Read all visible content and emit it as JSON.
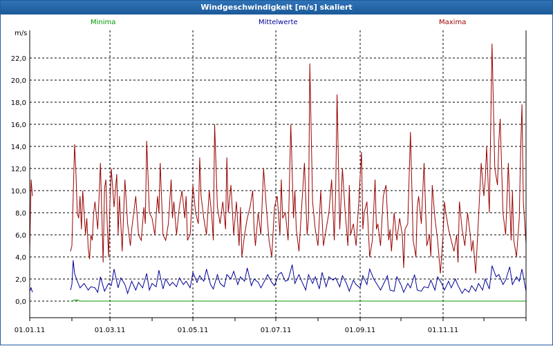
{
  "window": {
    "title": "Windgeschwindigkeit [m/s] skaliert"
  },
  "colors": {
    "minima": "#009900",
    "mean": "#000099",
    "maxima": "#990000",
    "grid": "#000000",
    "axis": "#000000"
  },
  "chart_data": {
    "type": "line",
    "title": "Windgeschwindigkeit [m/s] skaliert",
    "ylabel": "m/s",
    "xlabel": "",
    "ylim": [
      -1.5,
      24.5
    ],
    "yticks": [
      "0,0",
      "2,0",
      "4,0",
      "6,0",
      "8,0",
      "10,0",
      "12,0",
      "14,0",
      "16,0",
      "18,0",
      "20,0",
      "22,0"
    ],
    "ytick_values": [
      0,
      2,
      4,
      6,
      8,
      10,
      12,
      14,
      16,
      18,
      20,
      22
    ],
    "xlim": [
      0,
      365
    ],
    "xticks": [
      "01.01.11",
      "01.03.11",
      "01.05.11",
      "01.07.11",
      "01.09.11",
      "01.11.11"
    ],
    "xtick_days": [
      0,
      59,
      120,
      181,
      243,
      304
    ],
    "grid": true,
    "legend": [
      "Minima",
      "Mittelwerte",
      "Maxima"
    ],
    "series": [
      {
        "name": "Minima",
        "x": [
          0,
          2,
          5,
          30,
          31,
          33,
          35,
          37,
          40,
          45,
          50,
          60,
          70,
          80,
          90,
          100,
          110,
          120,
          130,
          140,
          150,
          160,
          170,
          180,
          190,
          200,
          210,
          220,
          230,
          240,
          250,
          260,
          270,
          280,
          290,
          300,
          310,
          320,
          330,
          340,
          350,
          360,
          365
        ],
        "values": [
          null,
          null,
          null,
          0.0,
          0.0,
          0.1,
          0.1,
          0.0,
          0.0,
          0.0,
          0.0,
          0.0,
          0.0,
          0.0,
          0.0,
          0.0,
          0.0,
          0.0,
          0.0,
          0.0,
          0.0,
          0.0,
          0.0,
          0.0,
          0.0,
          0.0,
          0.0,
          0.0,
          0.0,
          0.0,
          0.0,
          0.0,
          0.0,
          0.0,
          0.0,
          0.0,
          0.0,
          0.0,
          0.0,
          0.0,
          0.0,
          0.0,
          0.0
        ]
      },
      {
        "name": "Mittelwerte",
        "x": [
          0,
          1,
          2,
          30,
          31,
          32,
          33,
          35,
          37,
          40,
          43,
          45,
          48,
          50,
          52,
          55,
          58,
          60,
          62,
          65,
          67,
          70,
          72,
          75,
          78,
          80,
          83,
          86,
          88,
          90,
          93,
          95,
          98,
          100,
          103,
          105,
          108,
          110,
          113,
          115,
          118,
          120,
          123,
          125,
          128,
          130,
          133,
          135,
          138,
          140,
          143,
          145,
          148,
          150,
          153,
          155,
          158,
          160,
          163,
          165,
          168,
          170,
          173,
          175,
          178,
          180,
          183,
          185,
          188,
          190,
          193,
          195,
          198,
          200,
          203,
          205,
          208,
          210,
          213,
          215,
          218,
          220,
          223,
          225,
          228,
          230,
          233,
          235,
          238,
          240,
          243,
          245,
          248,
          250,
          253,
          255,
          258,
          260,
          263,
          265,
          268,
          270,
          273,
          275,
          278,
          280,
          283,
          285,
          288,
          290,
          293,
          295,
          298,
          300,
          303,
          305,
          308,
          310,
          313,
          315,
          318,
          320,
          323,
          325,
          328,
          330,
          333,
          335,
          338,
          340,
          343,
          345,
          348,
          350,
          353,
          355,
          358,
          360,
          362,
          365
        ],
        "values": [
          0.9,
          1.2,
          0.8,
          1.0,
          1.5,
          3.7,
          2.5,
          1.8,
          1.2,
          1.6,
          1.0,
          1.3,
          1.2,
          0.8,
          2.2,
          0.9,
          1.6,
          1.4,
          2.9,
          1.2,
          2.1,
          1.5,
          0.7,
          1.8,
          1.0,
          1.7,
          1.2,
          2.5,
          1.0,
          1.6,
          1.3,
          2.8,
          1.1,
          2.0,
          1.4,
          1.7,
          1.3,
          2.1,
          1.5,
          1.8,
          1.2,
          2.6,
          1.7,
          2.3,
          1.8,
          2.9,
          1.5,
          1.1,
          2.4,
          1.6,
          1.3,
          2.4,
          2.0,
          2.7,
          1.5,
          2.2,
          1.8,
          3.0,
          1.4,
          2.0,
          1.7,
          1.2,
          1.9,
          2.4,
          1.7,
          1.4,
          2.4,
          2.6,
          1.8,
          1.9,
          3.3,
          1.6,
          2.4,
          1.8,
          1.0,
          2.4,
          1.6,
          2.2,
          1.1,
          2.6,
          1.3,
          2.2,
          1.9,
          2.1,
          1.3,
          2.3,
          1.6,
          0.9,
          1.9,
          1.5,
          1.2,
          2.3,
          1.5,
          2.9,
          2.0,
          1.6,
          1.0,
          1.5,
          2.3,
          1.0,
          0.9,
          2.2,
          1.5,
          0.8,
          1.6,
          1.2,
          2.4,
          1.0,
          0.9,
          1.3,
          1.2,
          1.9,
          1.0,
          2.2,
          1.6,
          1.0,
          1.8,
          1.2,
          2.0,
          1.4,
          0.7,
          1.1,
          0.8,
          1.4,
          0.9,
          1.6,
          1.0,
          2.0,
          1.1,
          3.2,
          2.2,
          2.4,
          1.5,
          1.9,
          3.1,
          1.5,
          2.2,
          1.8,
          2.9,
          0.9
        ]
      },
      {
        "name": "Maxima",
        "x": [
          0,
          1,
          2,
          30,
          31,
          32,
          33,
          34,
          35,
          36,
          37,
          38,
          39,
          40,
          41,
          42,
          43,
          44,
          45,
          46,
          47,
          48,
          50,
          52,
          54,
          55,
          56,
          57,
          58,
          59,
          60,
          62,
          64,
          65,
          66,
          68,
          70,
          72,
          74,
          75,
          76,
          78,
          80,
          82,
          84,
          85,
          86,
          88,
          90,
          92,
          94,
          95,
          96,
          98,
          100,
          102,
          104,
          105,
          106,
          108,
          110,
          112,
          114,
          115,
          116,
          118,
          120,
          122,
          124,
          125,
          126,
          128,
          130,
          132,
          134,
          135,
          136,
          138,
          140,
          142,
          144,
          145,
          146,
          148,
          150,
          152,
          154,
          155,
          156,
          158,
          160,
          162,
          164,
          165,
          166,
          168,
          170,
          172,
          174,
          175,
          176,
          178,
          180,
          182,
          184,
          185,
          186,
          188,
          190,
          192,
          194,
          195,
          196,
          198,
          200,
          202,
          204,
          205,
          206,
          208,
          210,
          212,
          214,
          215,
          216,
          218,
          220,
          222,
          224,
          225,
          226,
          228,
          230,
          232,
          234,
          235,
          236,
          238,
          240,
          242,
          244,
          245,
          246,
          248,
          250,
          252,
          254,
          255,
          256,
          258,
          260,
          262,
          264,
          265,
          266,
          268,
          270,
          272,
          274,
          275,
          276,
          278,
          280,
          282,
          284,
          285,
          286,
          288,
          290,
          292,
          294,
          295,
          296,
          298,
          300,
          302,
          304,
          305,
          306,
          308,
          310,
          312,
          314,
          315,
          316,
          318,
          320,
          322,
          324,
          325,
          326,
          328,
          330,
          332,
          334,
          335,
          336,
          338,
          340,
          342,
          344,
          345,
          346,
          348,
          350,
          352,
          354,
          355,
          356,
          358,
          360,
          361,
          362,
          363,
          365
        ],
        "values": [
          4.5,
          11.0,
          9.5,
          4.5,
          5.0,
          9.5,
          14.2,
          11.5,
          8.0,
          7.5,
          9.5,
          6.5,
          10.0,
          8.0,
          6.0,
          7.5,
          4.8,
          3.8,
          6.0,
          5.5,
          8.0,
          9.0,
          6.5,
          12.5,
          3.5,
          10.2,
          11.0,
          7.0,
          4.0,
          9.0,
          12.0,
          8.5,
          11.5,
          6.0,
          9.5,
          4.5,
          11.0,
          7.0,
          5.0,
          6.5,
          7.5,
          9.5,
          6.0,
          5.5,
          8.5,
          7.0,
          14.5,
          8.0,
          7.5,
          6.0,
          9.5,
          8.0,
          12.5,
          6.0,
          5.5,
          7.0,
          11.0,
          7.5,
          9.0,
          6.0,
          8.5,
          10.0,
          7.5,
          9.5,
          5.5,
          6.0,
          10.5,
          8.0,
          7.0,
          13.0,
          9.5,
          7.5,
          6.0,
          10.0,
          7.5,
          5.5,
          16.0,
          8.5,
          7.0,
          9.0,
          6.5,
          13.0,
          8.0,
          10.5,
          6.0,
          9.0,
          5.0,
          8.5,
          4.0,
          6.0,
          7.5,
          8.5,
          10.0,
          6.5,
          5.0,
          8.0,
          6.0,
          12.0,
          8.5,
          7.0,
          5.5,
          4.0,
          8.5,
          9.5,
          6.0,
          11.0,
          7.5,
          8.0,
          5.5,
          16.0,
          7.5,
          10.0,
          6.5,
          4.5,
          8.5,
          12.5,
          6.0,
          7.5,
          21.5,
          9.0,
          6.5,
          5.0,
          10.0,
          7.5,
          5.0,
          6.5,
          8.0,
          11.0,
          5.5,
          10.0,
          18.7,
          6.5,
          12.0,
          8.0,
          5.0,
          10.5,
          6.0,
          7.0,
          5.0,
          9.0,
          13.5,
          6.5,
          8.0,
          9.0,
          4.0,
          5.5,
          11.0,
          6.5,
          7.0,
          5.0,
          9.5,
          10.5,
          5.5,
          6.5,
          4.5,
          8.0,
          5.5,
          7.5,
          6.0,
          3.0,
          6.5,
          7.0,
          15.3,
          5.5,
          4.0,
          8.5,
          9.5,
          7.0,
          12.5,
          5.0,
          6.0,
          4.0,
          10.5,
          7.5,
          5.5,
          2.5,
          6.0,
          9.0,
          8.0,
          6.5,
          5.5,
          4.5,
          6.0,
          3.5,
          9.0,
          6.5,
          5.0,
          8.0,
          6.0,
          4.5,
          5.5,
          2.5,
          7.5,
          12.5,
          9.5,
          11.0,
          14.0,
          8.0,
          23.3,
          12.0,
          10.5,
          14.5,
          16.5,
          8.0,
          6.0,
          12.5,
          5.5,
          10.0,
          5.5,
          4.0,
          7.5,
          13.5,
          17.8,
          9.0,
          5.2
        ]
      }
    ]
  }
}
